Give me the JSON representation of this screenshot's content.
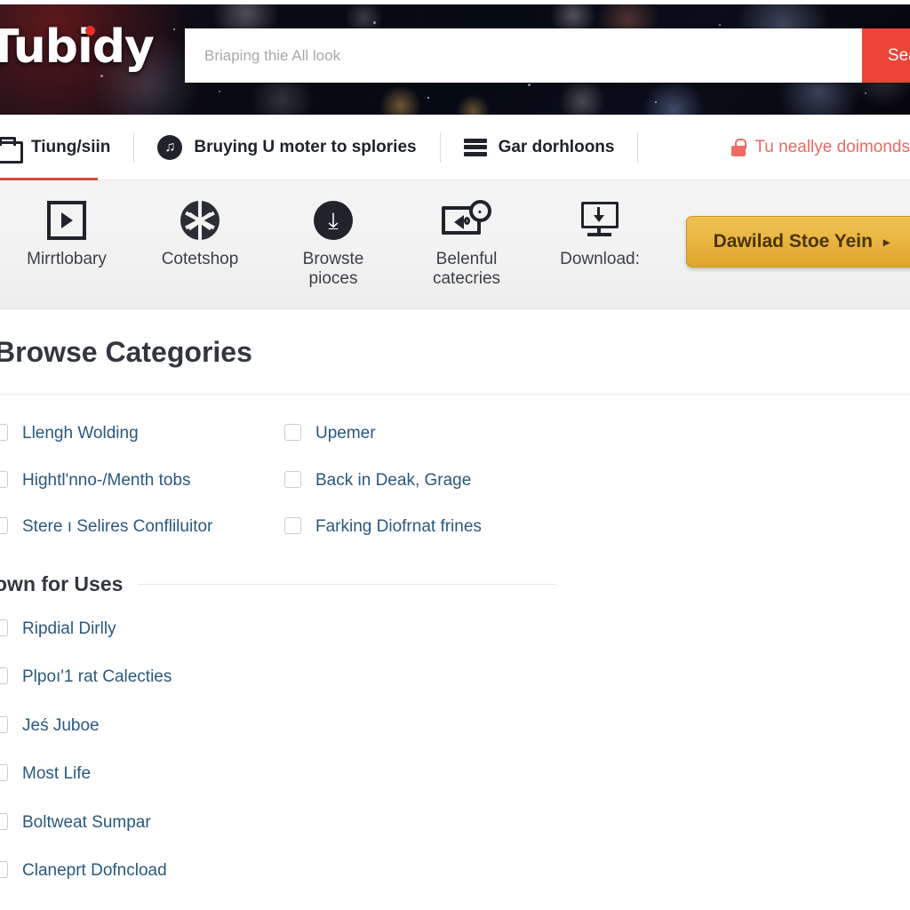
{
  "brand": {
    "logo_text": "Tubidy",
    "logo_dot_color": "#e8302a"
  },
  "search": {
    "placeholder": "Briaping thie All look",
    "value": "",
    "button_label": "Search",
    "button_color": "#ec4437"
  },
  "nav": {
    "items": [
      {
        "label": "Tiung/siin",
        "icon": "folder-icon",
        "active": true
      },
      {
        "label": "Bruying U moter to splories",
        "icon": "music-note-icon",
        "active": false
      },
      {
        "label": "Gar dorhloons",
        "icon": "list-lines-icon",
        "active": false
      }
    ],
    "right_link": {
      "label": "Tu neallye doimonds",
      "icon": "lock-icon",
      "color": "#eb6a63"
    },
    "active_underline_color": "#d9493e"
  },
  "toolbar": {
    "tools": [
      {
        "label": "Mirrtlobary",
        "icon": "play-square-icon"
      },
      {
        "label": "Cotetshop",
        "icon": "pinwheel-circle-icon"
      },
      {
        "label": "Browste pioces",
        "icon": "download-circle-icon"
      },
      {
        "label": "Belenful catecries",
        "icon": "screen-speaker-icon"
      },
      {
        "label": "Download:",
        "icon": "monitor-download-icon"
      }
    ],
    "cta": {
      "label": "Dawilad Stoe Yein",
      "caret": "▸",
      "color": "#eab843"
    }
  },
  "main": {
    "title": "Browse Categories",
    "categories": {
      "left": [
        {
          "label": "Llengh Wolding",
          "checked": false
        },
        {
          "label": "Hightl'nno-/Menth tobs",
          "checked": false
        },
        {
          "label": "Stere ı Selires Confliluitor",
          "checked": false
        }
      ],
      "right": [
        {
          "label": "Upemer",
          "checked": false
        },
        {
          "label": "Back in Deak, Grage",
          "checked": false
        },
        {
          "label": "Farking Diofrnat frines",
          "checked": false
        }
      ]
    },
    "subsection": {
      "title": "own for Uses",
      "items": [
        {
          "label": "Ripdial Dirlly",
          "checked": false
        },
        {
          "label": "Plpoı'1 rat Calecties",
          "checked": false
        },
        {
          "label": "Jeś Juboe",
          "checked": false
        },
        {
          "label": "Most Life",
          "checked": false
        },
        {
          "label": "Boltweat Sumpar",
          "checked": false
        },
        {
          "label": "Claneprt Dofncload",
          "checked": false
        }
      ]
    }
  }
}
